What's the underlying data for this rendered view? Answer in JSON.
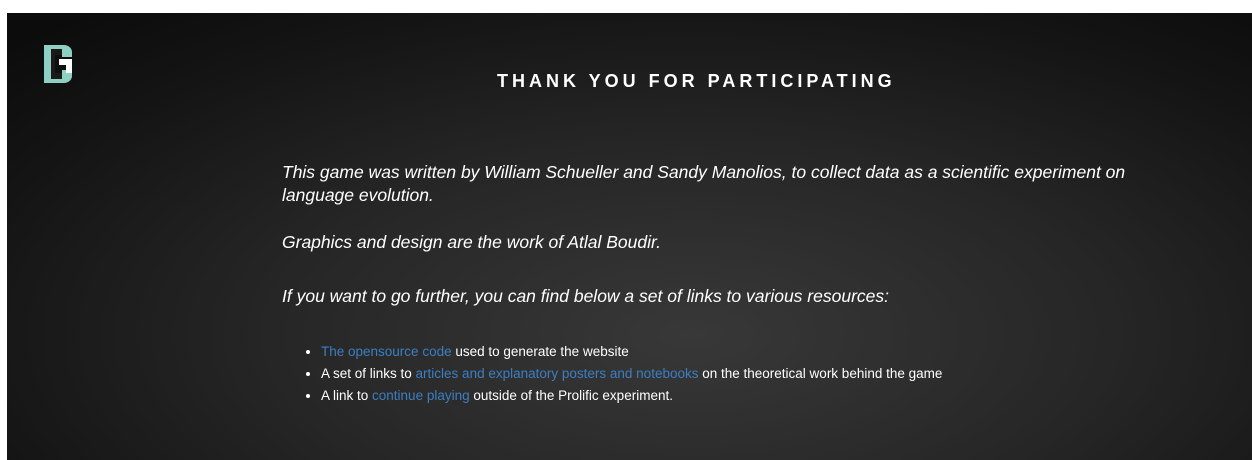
{
  "colors": {
    "background": "#222222",
    "text": "#ffffff",
    "link": "#3b7fc2",
    "logo_teal": "#8fd0c4"
  },
  "logo": {
    "icon": "game-logo-icon"
  },
  "page_title": "THANK YOU FOR PARTICIPATING",
  "paragraphs": [
    "This game was written by William Schueller and Sandy Manolios, to collect data as a scientific experiment on language evolution.",
    "Graphics and design are the work of Atlal Boudir.",
    "If you want to go further, you can find below a set of links to various resources:"
  ],
  "links": [
    {
      "pre": "",
      "link": "The opensource code",
      "post": " used to generate the website"
    },
    {
      "pre": "A set of links to ",
      "link": "articles and explanatory posters and notebooks",
      "post": " on the theoretical work behind the game"
    },
    {
      "pre": "A link to ",
      "link": "continue playing",
      "post": " outside of the Prolific experiment."
    }
  ]
}
